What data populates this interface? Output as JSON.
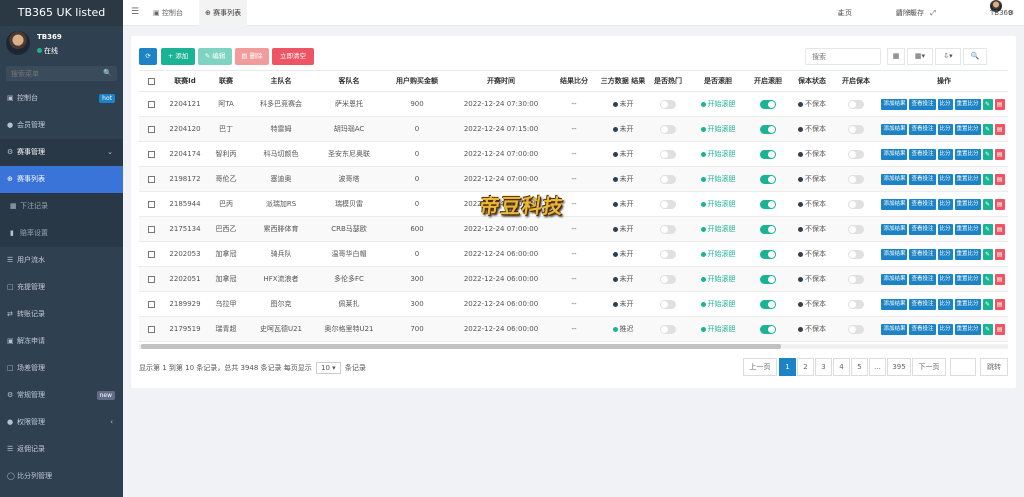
{
  "app": {
    "title": "TB365 UK listed"
  },
  "user": {
    "name": "TB369",
    "status": "在线"
  },
  "sidebar": {
    "search_placeholder": "搜索菜单",
    "items": [
      {
        "label": "控制台",
        "icon": "monitor-icon",
        "badge": "hot"
      },
      {
        "label": "会员管理",
        "icon": "user-icon"
      },
      {
        "label": "赛事管理",
        "icon": "gear-icon"
      },
      {
        "label": "赛事列表",
        "icon": "circle-plus-icon"
      },
      {
        "label": "下注记录",
        "icon": "calendar-icon"
      },
      {
        "label": "赔率设置",
        "icon": "bars-icon"
      },
      {
        "label": "用户流水",
        "icon": "list-icon"
      },
      {
        "label": "充提管理",
        "icon": "square-icon"
      },
      {
        "label": "转账记录",
        "icon": "transfer-icon"
      },
      {
        "label": "解冻申请",
        "icon": "unlock-icon"
      },
      {
        "label": "场差管理",
        "icon": "square-icon"
      },
      {
        "label": "常规管理",
        "icon": "gear-icon",
        "badge": "new"
      },
      {
        "label": "权限管理",
        "icon": "group-icon"
      },
      {
        "label": "返佣记录",
        "icon": "list-icon"
      },
      {
        "label": "比分列管理",
        "icon": "circle-icon"
      }
    ]
  },
  "topbar": {
    "tabs": [
      {
        "label": "控制台"
      },
      {
        "label": "赛事列表"
      }
    ],
    "home": "主页",
    "clear_cache": "清除缓存",
    "username": "TB369"
  },
  "toolbar": {
    "add": "添加",
    "edit": "编辑",
    "delete": "删除",
    "clear": "立即清空",
    "search_placeholder": "搜索"
  },
  "table": {
    "columns": [
      "联赛Id",
      "联赛",
      "主队名",
      "客队名",
      "用户购买金额",
      "开赛时间",
      "结果比分",
      "三方数据 结果",
      "是否热门",
      "是否滚胆",
      "开启滚胆",
      "保本状态",
      "开启保本",
      "操作"
    ],
    "actions": [
      "添加结果",
      "查看投注",
      "比分",
      "重置比分"
    ],
    "rows": [
      {
        "id": "2204121",
        "league": "阿TA",
        "home": "科多巴竞赛会",
        "away": "萨米恩托",
        "amount": "900",
        "time": "2022-12-24 07:30:00",
        "score": "--",
        "result": "未开",
        "rolling": "开始滚胆",
        "keep": "不保本"
      },
      {
        "id": "2204120",
        "league": "巴丁",
        "home": "特雷姆",
        "away": "胡玛瑙AC",
        "amount": "0",
        "time": "2022-12-24 07:15:00",
        "score": "--",
        "result": "未开",
        "rolling": "开始滚胆",
        "keep": "不保本"
      },
      {
        "id": "2204174",
        "league": "智利丙",
        "home": "科马切颜色",
        "away": "圣安东尼奥联",
        "amount": "0",
        "time": "2022-12-24 07:00:00",
        "score": "--",
        "result": "未开",
        "rolling": "开始滚胆",
        "keep": "不保本"
      },
      {
        "id": "2198172",
        "league": "哥伦乙",
        "home": "塞迪奥",
        "away": "波哥塔",
        "amount": "0",
        "time": "2022-12-24 07:00:00",
        "score": "--",
        "result": "未开",
        "rolling": "开始滚胆",
        "keep": "不保本"
      },
      {
        "id": "2185944",
        "league": "巴丙",
        "home": "派瑞加RS",
        "away": "瑞模贝雷",
        "amount": "0",
        "time": "2022-12-24 07:00:00",
        "score": "--",
        "result": "未开",
        "rolling": "开始滚胆",
        "keep": "不保本"
      },
      {
        "id": "2175134",
        "league": "巴西乙",
        "home": "累西腓体育",
        "away": "CRB马瑟欧",
        "amount": "600",
        "time": "2022-12-24 07:00:00",
        "score": "--",
        "result": "未开",
        "rolling": "开始滚胆",
        "keep": "不保本"
      },
      {
        "id": "2202053",
        "league": "加拿冠",
        "home": "骑兵队",
        "away": "温哥华白帽",
        "amount": "0",
        "time": "2022-12-24 06:00:00",
        "score": "--",
        "result": "未开",
        "rolling": "开始滚胆",
        "keep": "不保本"
      },
      {
        "id": "2202051",
        "league": "加拿冠",
        "home": "HFX流浪者",
        "away": "多伦多FC",
        "amount": "300",
        "time": "2022-12-24 06:00:00",
        "score": "--",
        "result": "未开",
        "rolling": "开始滚胆",
        "keep": "不保本"
      },
      {
        "id": "2189929",
        "league": "乌拉甲",
        "home": "图尔克",
        "away": "佩莱扎",
        "amount": "300",
        "time": "2022-12-24 06:00:00",
        "score": "--",
        "result": "未开",
        "rolling": "开始滚胆",
        "keep": "不保本"
      },
      {
        "id": "2179519",
        "league": "瑞青超",
        "home": "史呵瓦德U21",
        "away": "奥尔格里特U21",
        "amount": "700",
        "time": "2022-12-24 06:00:00",
        "score": "--",
        "result": "推迟",
        "rolling": "开始滚胆",
        "keep": "不保本"
      }
    ]
  },
  "footer": {
    "summary_prefix": "显示第 1 到第 10 条记录，总共 3948 条记录 每页显示",
    "page_size": "10",
    "summary_suffix": "条记录",
    "prev": "上一页",
    "next": "下一页",
    "pages": [
      "1",
      "2",
      "3",
      "4",
      "5",
      "...",
      "395"
    ],
    "jump": "跳转"
  },
  "watermark": "帝豆科技"
}
